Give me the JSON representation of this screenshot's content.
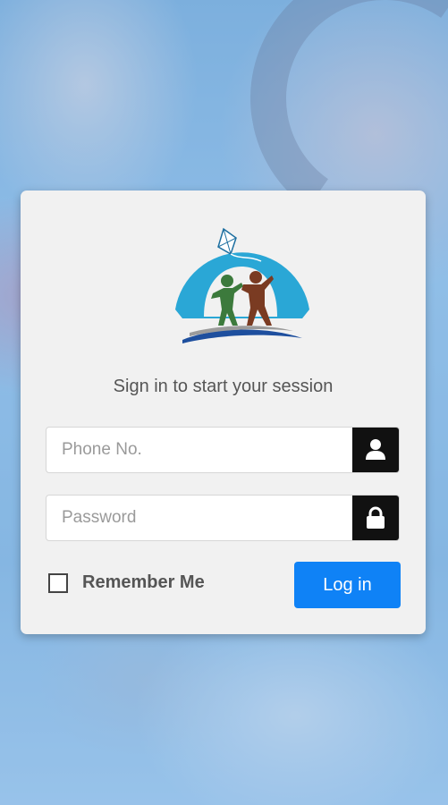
{
  "login": {
    "subtitle": "Sign in to start your session",
    "phone_placeholder": "Phone No.",
    "password_placeholder": "Password",
    "remember_label": "Remember Me",
    "login_label": "Log in"
  },
  "icons": {
    "phone_addon": "user-icon",
    "password_addon": "lock-icon"
  },
  "colors": {
    "primary_button": "#0f82f6",
    "addon_background": "#111111",
    "logo_blue": "#2aa7d6",
    "logo_green": "#3c7a3c",
    "logo_brown": "#7a3b22",
    "logo_base": "#1e4f9e"
  }
}
